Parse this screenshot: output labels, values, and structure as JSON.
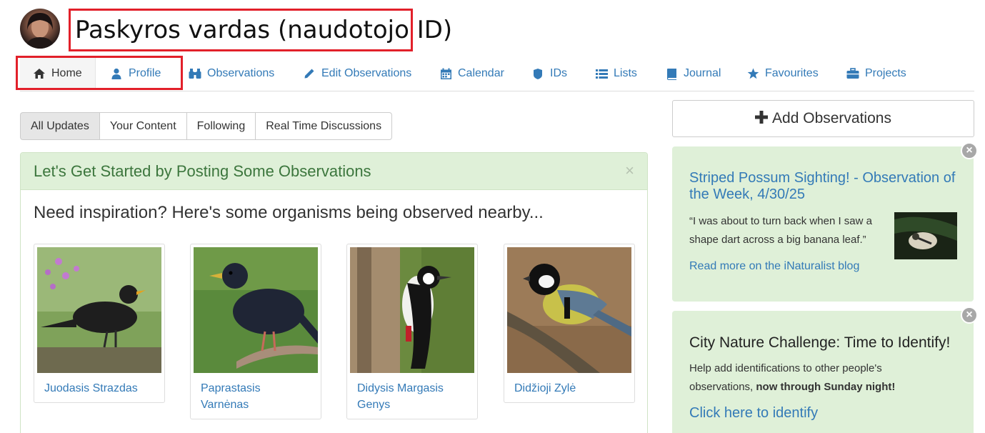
{
  "header": {
    "username": "Paskyros vardas (naudotojo ID)"
  },
  "nav": {
    "items": [
      {
        "label": "Home",
        "icon": "home-icon"
      },
      {
        "label": "Profile",
        "icon": "user-icon"
      },
      {
        "label": "Observations",
        "icon": "binoculars-icon"
      },
      {
        "label": "Edit Observations",
        "icon": "pencil-icon"
      },
      {
        "label": "Calendar",
        "icon": "calendar-icon"
      },
      {
        "label": "IDs",
        "icon": "identification-icon"
      },
      {
        "label": "Lists",
        "icon": "list-icon"
      },
      {
        "label": "Journal",
        "icon": "book-icon"
      },
      {
        "label": "Favourites",
        "icon": "star-icon"
      },
      {
        "label": "Projects",
        "icon": "briefcase-icon"
      }
    ]
  },
  "tabs": [
    "All Updates",
    "Your Content",
    "Following",
    "Real Time Discussions"
  ],
  "panel": {
    "title": "Let's Get Started by Posting Some Observations",
    "close": "×",
    "inspiration": "Need inspiration? Here's some organisms being observed nearby...",
    "organisms": [
      {
        "name": "Juodasis Strazdas"
      },
      {
        "name": "Paprastasis Varnėnas"
      },
      {
        "name": "Didysis Margasis Genys"
      },
      {
        "name": "Didžioji Zylė"
      }
    ]
  },
  "sidebar": {
    "add_button": "Add Observations",
    "card1": {
      "title": "Striped Possum Sighting! - Observation of the Week, 4/30/25",
      "quote": "“I was about to turn back when I saw a shape dart across a big banana leaf.”",
      "link": "Read more on the iNaturalist blog"
    },
    "card2": {
      "title": "City Nature Challenge: Time to Identify!",
      "text": "Help add identifications to other people's observations,",
      "text_bold": "now through Sunday night!",
      "link": "Click here to identify"
    }
  },
  "colors": {
    "link": "#337ab7",
    "highlight": "#e2202a",
    "alert_bg": "#dff0d8",
    "alert_text": "#3c763d"
  }
}
